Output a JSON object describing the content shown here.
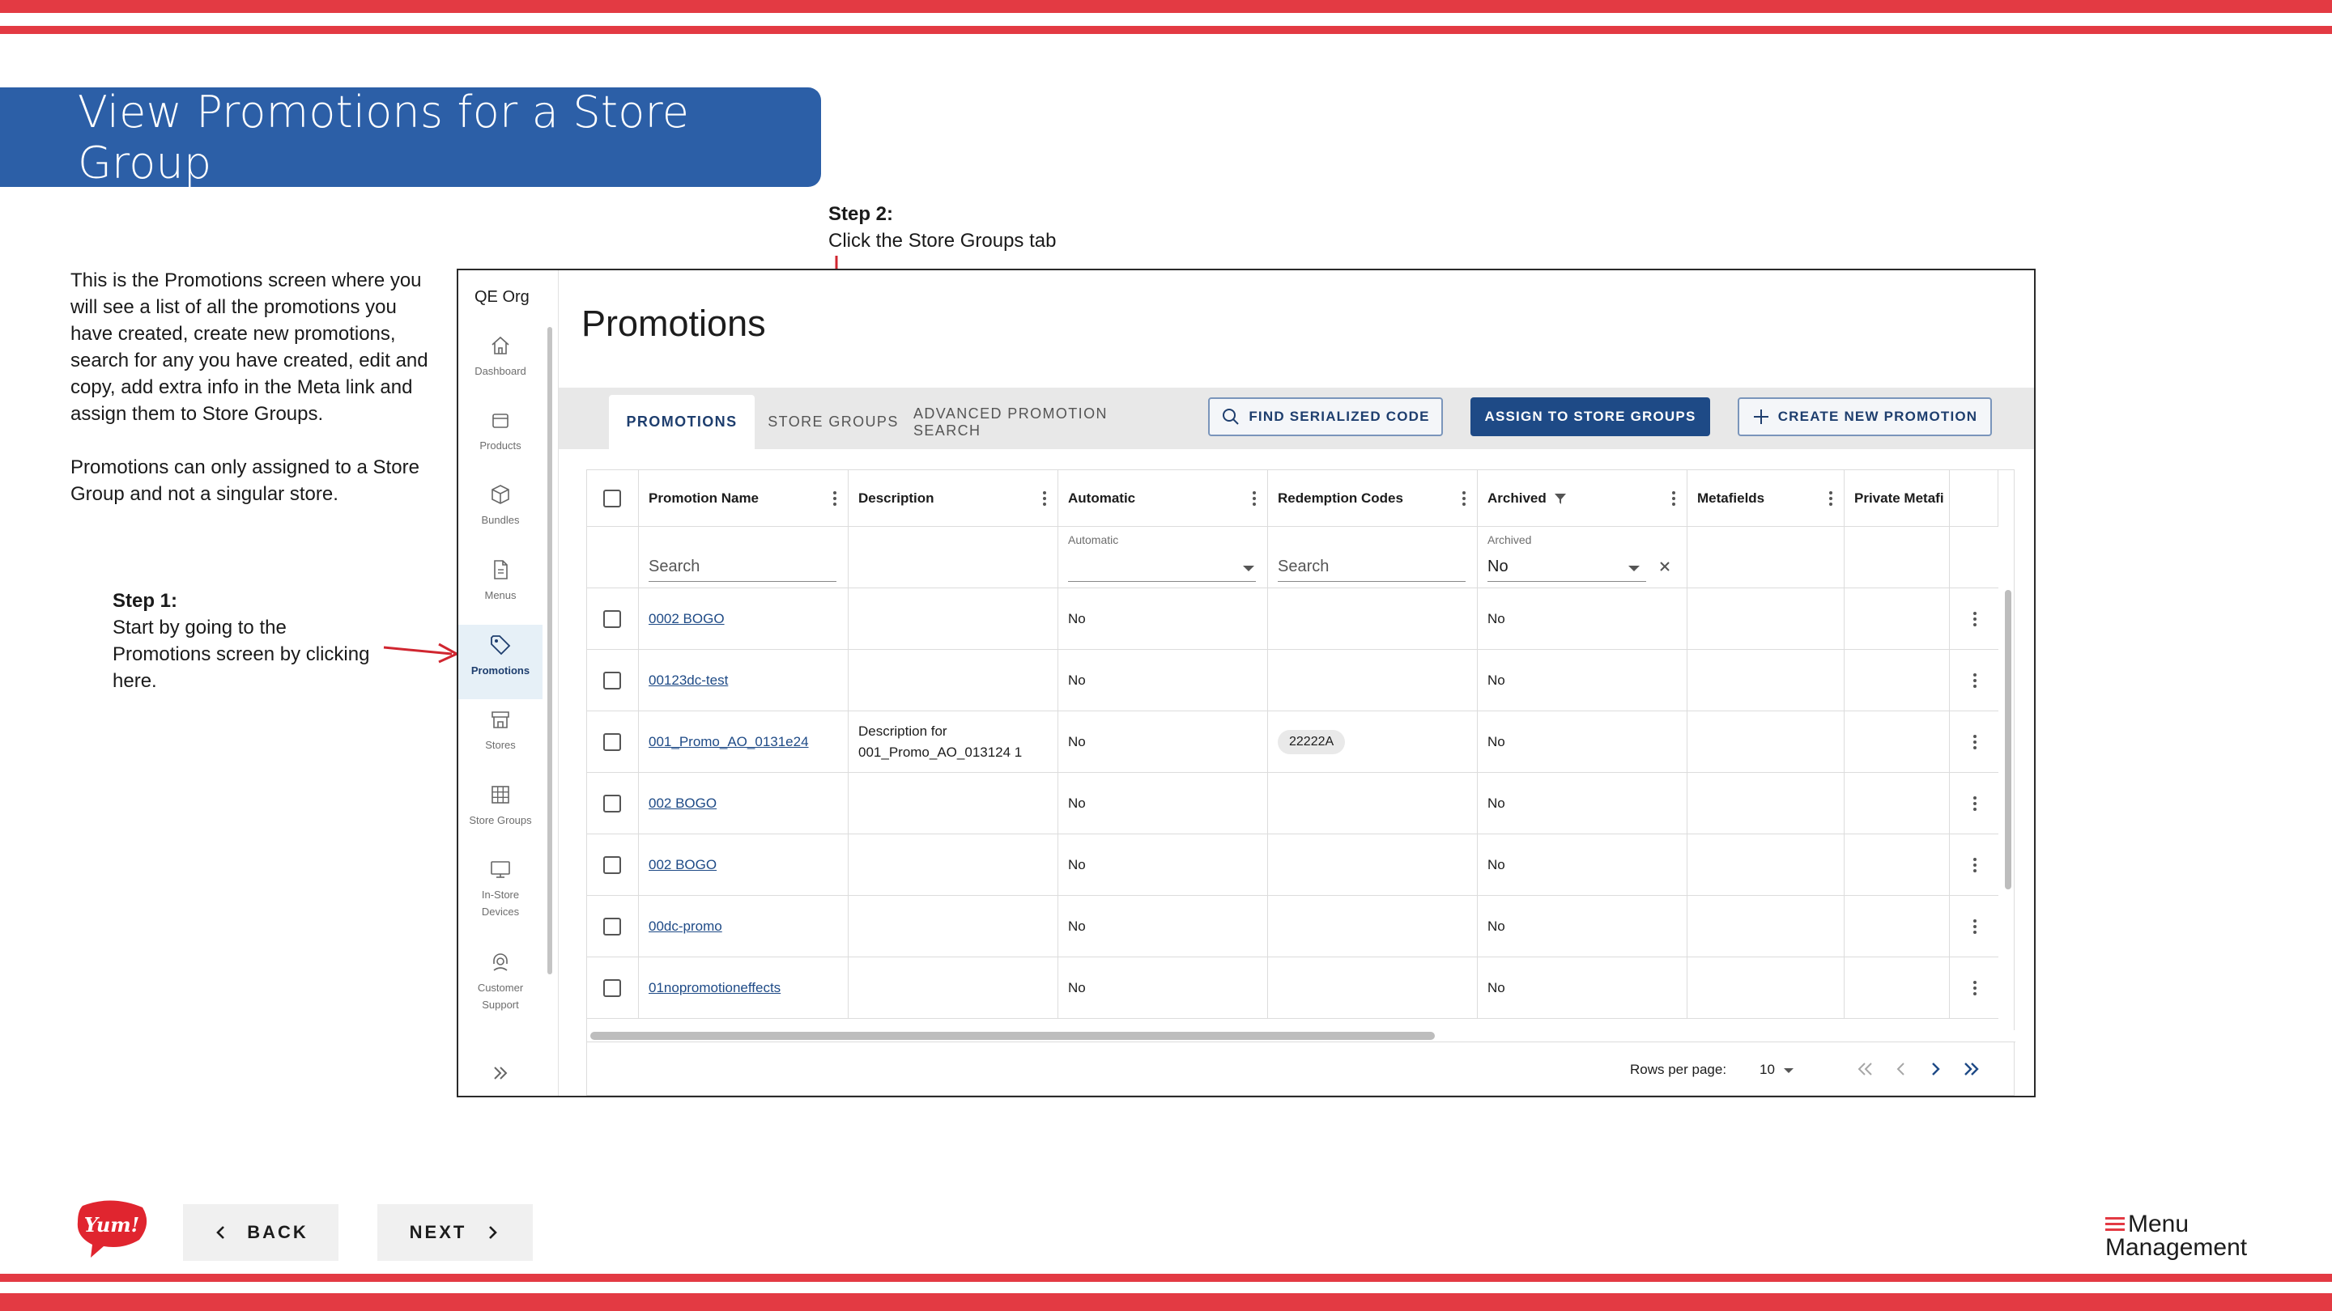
{
  "slide": {
    "title": "View Promotions for a Store Group",
    "intro_p1": "This is the Promotions screen where you will see a list of all the promotions you have created, create new promotions, search for any you have created, edit and copy, add extra info in the Meta link and assign them to Store Groups.",
    "intro_p2": "Promotions can only assigned to a Store Group and not a singular store.",
    "step1_title": "Step 1:",
    "step1_text": "Start by going to the Promotions screen by clicking here.",
    "step2_title": "Step 2:",
    "step2_text": "Click the Store Groups tab",
    "accent_color": "#e33a43",
    "banner_color": "#2c5fa7"
  },
  "app": {
    "org": "QE Org",
    "nav": [
      {
        "label": "Dashboard",
        "icon": "home-icon"
      },
      {
        "label": "Products",
        "icon": "box-icon"
      },
      {
        "label": "Bundles",
        "icon": "cube-icon"
      },
      {
        "label": "Menus",
        "icon": "document-icon"
      },
      {
        "label": "Promotions",
        "icon": "tag-icon",
        "active": true
      },
      {
        "label": "Stores",
        "icon": "store-icon"
      },
      {
        "label": "Store Groups",
        "icon": "grid-icon"
      },
      {
        "label": "In-Store Devices",
        "icon": "monitor-icon"
      },
      {
        "label": "Customer Support",
        "icon": "headset-icon"
      }
    ],
    "page_title": "Promotions",
    "tabs": [
      "PROMOTIONS",
      "STORE GROUPS",
      "ADVANCED PROMOTION SEARCH"
    ],
    "buttons": {
      "find": "FIND SERIALIZED CODE",
      "assign": "ASSIGN TO STORE GROUPS",
      "create": "CREATE NEW PROMOTION"
    },
    "columns": [
      "Promotion Name",
      "Description",
      "Automatic",
      "Redemption Codes",
      "Archived",
      "Metafields",
      "Private Metafi"
    ],
    "filters": {
      "name_placeholder": "Search",
      "automatic_label": "Automatic",
      "codes_placeholder": "Search",
      "archived_label": "Archived",
      "archived_value": "No"
    },
    "rows": [
      {
        "name": "0002 BOGO",
        "desc1": "",
        "desc2": "",
        "automatic": "No",
        "code": "",
        "archived": "No"
      },
      {
        "name": "00123dc-test",
        "desc1": "",
        "desc2": "",
        "automatic": "No",
        "code": "",
        "archived": "No"
      },
      {
        "name": "001_Promo_AO_0131e24",
        "desc1": "Description for",
        "desc2": "001_Promo_AO_013124 1",
        "automatic": "No",
        "code": "22222A",
        "archived": "No"
      },
      {
        "name": "002 BOGO",
        "desc1": "",
        "desc2": "",
        "automatic": "No",
        "code": "",
        "archived": "No"
      },
      {
        "name": "002 BOGO",
        "desc1": "",
        "desc2": "",
        "automatic": "No",
        "code": "",
        "archived": "No"
      },
      {
        "name": "00dc-promo",
        "desc1": "",
        "desc2": "",
        "automatic": "No",
        "code": "",
        "archived": "No"
      },
      {
        "name": "01nopromotioneffects",
        "desc1": "",
        "desc2": "",
        "automatic": "No",
        "code": "",
        "archived": "No"
      }
    ],
    "pagination": {
      "label": "Rows per page:",
      "value": "10"
    }
  },
  "footer": {
    "back": "BACK",
    "next": "NEXT",
    "logo_text": "Yum!",
    "brand_line1": "Menu",
    "brand_line2": "Management"
  }
}
